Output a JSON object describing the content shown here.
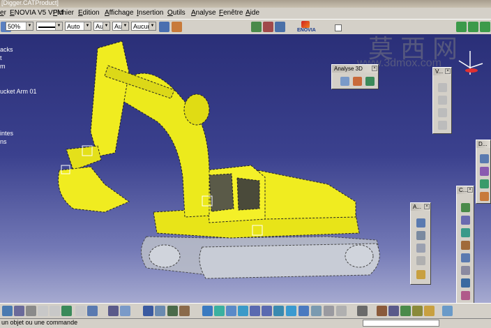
{
  "window": {
    "title": "[Digger.CATProduct]"
  },
  "menu": [
    {
      "label": "er"
    },
    {
      "label": "ENOVIA V5 VPM"
    },
    {
      "label": "Fichier"
    },
    {
      "label": "Edition"
    },
    {
      "label": "Affichage"
    },
    {
      "label": "Insertion"
    },
    {
      "label": "Outils"
    },
    {
      "label": "Analyse"
    },
    {
      "label": "Fenêtre"
    },
    {
      "label": "Aide"
    }
  ],
  "toolbar": {
    "zoom_value": "50%",
    "line_style": "",
    "thickness_value": "Auto",
    "layer_value": "Aut",
    "color_value": "Aut",
    "pattern_value": "Aucun",
    "enovia_label": "ENOVIA"
  },
  "tree": [
    {
      "label": "acks"
    },
    {
      "label": "t"
    },
    {
      "label": "m"
    },
    {
      "label": "ucket Arm 01"
    },
    {
      "label": "intes"
    },
    {
      "label": "ns"
    }
  ],
  "panels": {
    "analyse": {
      "title": "Analyse 3D"
    },
    "view": {
      "title": "V..."
    },
    "dmu": {
      "title": "D..."
    },
    "assembly": {
      "title": "A..."
    },
    "constraints": {
      "title": "C..."
    }
  },
  "watermark": {
    "chars": "莫 西 网",
    "url": "www.3dmox.com"
  },
  "status": {
    "message": "un objet ou une commande"
  },
  "colors": {
    "viewport_top": "#2a2f78",
    "viewport_bottom": "#a6aad0",
    "model": "#f0ec20",
    "chrome": "#d4d0c8"
  }
}
